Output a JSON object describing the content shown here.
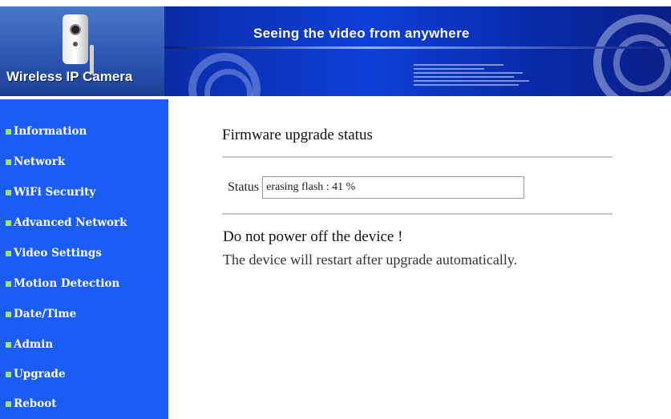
{
  "header": {
    "logo_text": "Wireless IP Camera",
    "tagline": "Seeing the video from anywhere"
  },
  "sidebar": {
    "items": [
      {
        "label": "Information"
      },
      {
        "label": "Network"
      },
      {
        "label": "WiFi Security"
      },
      {
        "label": "Advanced Network"
      },
      {
        "label": "Video Settings"
      },
      {
        "label": "Motion Detection"
      },
      {
        "label": "Date/Time"
      },
      {
        "label": "Admin"
      },
      {
        "label": "Upgrade"
      },
      {
        "label": "Reboot"
      }
    ]
  },
  "main": {
    "title": "Firmware upgrade status",
    "status_label": "Status",
    "status_value": "erasing flash : 41 %",
    "warning_title": "Do not power off the device !",
    "warning_text": "The device will restart after upgrade automatically."
  },
  "colors": {
    "sidebar_bg": "#1a5cf5",
    "banner_blue": "#0d3fd8",
    "bullet_green": "#9fe07a"
  }
}
